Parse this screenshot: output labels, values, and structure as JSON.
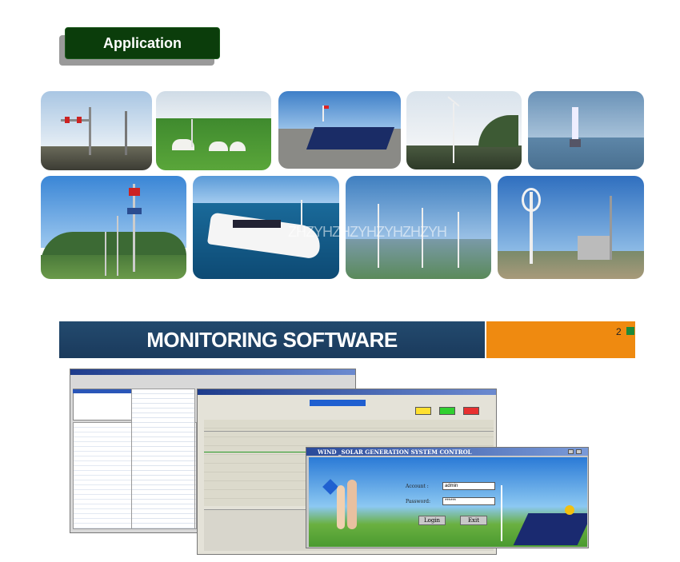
{
  "application": {
    "title": "Application"
  },
  "gallery": {
    "row1": [
      {
        "name": "street-lights"
      },
      {
        "name": "yurts-grassland"
      },
      {
        "name": "solar-array"
      },
      {
        "name": "wind-turbine-village"
      },
      {
        "name": "coastal-tower"
      }
    ],
    "row2": [
      {
        "name": "highway-lamps"
      },
      {
        "name": "yacht"
      },
      {
        "name": "seaside-turbines"
      },
      {
        "name": "telecom-station"
      }
    ],
    "watermark": "ZHZYHZHZYHZYHZHZYH"
  },
  "monitoring": {
    "title": "MONITORING SOFTWARE",
    "page_number": "2"
  },
  "login_window": {
    "title": "WIND _SOLAR GENERATION SYSTEM CONTROL",
    "account_label": "Account :",
    "account_value": "admin",
    "password_label": "Password:",
    "password_value": "******",
    "login_button": "Login",
    "exit_button": "Exit"
  },
  "colors": {
    "badge": "#0b3d0b",
    "banner": "#1a3a5c",
    "accent_orange": "#ef8a10",
    "accent_green": "#1d8a3a"
  }
}
